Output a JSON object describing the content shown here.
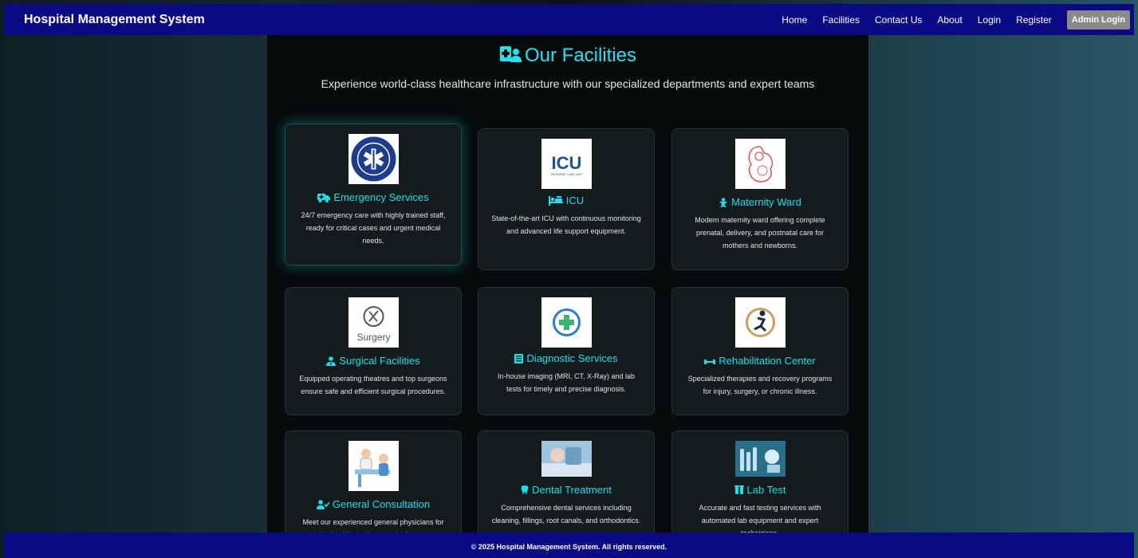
{
  "navbar": {
    "brand": "Hospital Management System",
    "links": [
      "Home",
      "Facilities",
      "Contact Us",
      "About",
      "Login",
      "Register"
    ],
    "admin_login": "Admin Login"
  },
  "page": {
    "title": "Our Facilities",
    "subtitle": "Experience world-class healthcare infrastructure with our specialized departments and expert teams"
  },
  "facilities": [
    {
      "title": "Emergency Services",
      "desc": "24/7 emergency care with highly trained staff, ready for critical cases and urgent medical needs.",
      "icon": "ambulance-icon"
    },
    {
      "title": "ICU",
      "desc": "State-of-the-art ICU with continuous monitoring and advanced life support equipment.",
      "icon": "procedures-icon"
    },
    {
      "title": "Maternity Ward",
      "desc": "Modern maternity ward offering complete prenatal, delivery, and postnatal care for mothers and newborns.",
      "icon": "baby-icon"
    },
    {
      "title": "Surgical Facilities",
      "desc": "Equipped operating theatres and top surgeons ensure safe and efficient surgical procedures.",
      "icon": "user-doctor-icon"
    },
    {
      "title": "Diagnostic Services",
      "desc": "In-house imaging (MRI, CT, X-Ray) and lab tests for timely and precise diagnosis.",
      "icon": "file-medical-icon"
    },
    {
      "title": "Rehabilitation Center",
      "desc": "Specialized therapies and recovery programs for injury, surgery, or chronic illness.",
      "icon": "dumbbell-icon"
    },
    {
      "title": "General Consultation",
      "desc": "Meet our experienced general physicians for routine health checkups and primary care",
      "icon": "user-check-icon"
    },
    {
      "title": "Dental Treatment",
      "desc": "Comprehensive dental services including cleaning, fillings, root canals, and orthodontics.",
      "icon": "tooth-icon"
    },
    {
      "title": "Lab Test",
      "desc": "Accurate and fast testing services with automated lab equipment and expert technicians.",
      "icon": "vials-icon"
    }
  ],
  "thumb_text": {
    "icu": "ICU",
    "icu_sub": "INTENSIVE CARE UNIT",
    "surgery": "Surgery"
  },
  "footer": "© 2025 Hospital Management System. All rights reserved.",
  "colors": {
    "navbar": "#0a0a84",
    "accent": "#1ee4f0",
    "card_bg": "#131b1d",
    "admin_btn": "#8a8a8a"
  }
}
